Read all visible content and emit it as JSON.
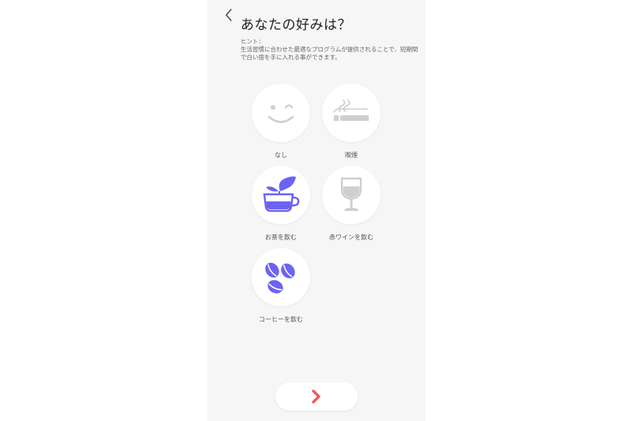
{
  "header": {
    "title": "あなたの好みは？"
  },
  "hint": {
    "label": "ヒント：",
    "text": "生活習慣に合わせた最適なプログラムが提供されることで、短期間で白い歯を手に入れる事ができます。"
  },
  "options": [
    {
      "label": "なし",
      "icon": "smile-wink-icon",
      "selected": false
    },
    {
      "label": "喫煙",
      "icon": "cigarette-icon",
      "selected": false
    },
    {
      "label": "お茶を飲む",
      "icon": "tea-cup-icon",
      "selected": true
    },
    {
      "label": "赤ワインを飲む",
      "icon": "wine-glass-icon",
      "selected": false
    },
    {
      "label": "コーヒーを飲む",
      "icon": "coffee-beans-icon",
      "selected": true
    }
  ],
  "colors": {
    "accent": "#6c63f2",
    "inactive": "#cfcfcf",
    "next_arrow": "#f05a5a",
    "background": "#f6f6f6"
  },
  "footer": {
    "next_icon": "chevron-right-icon"
  }
}
